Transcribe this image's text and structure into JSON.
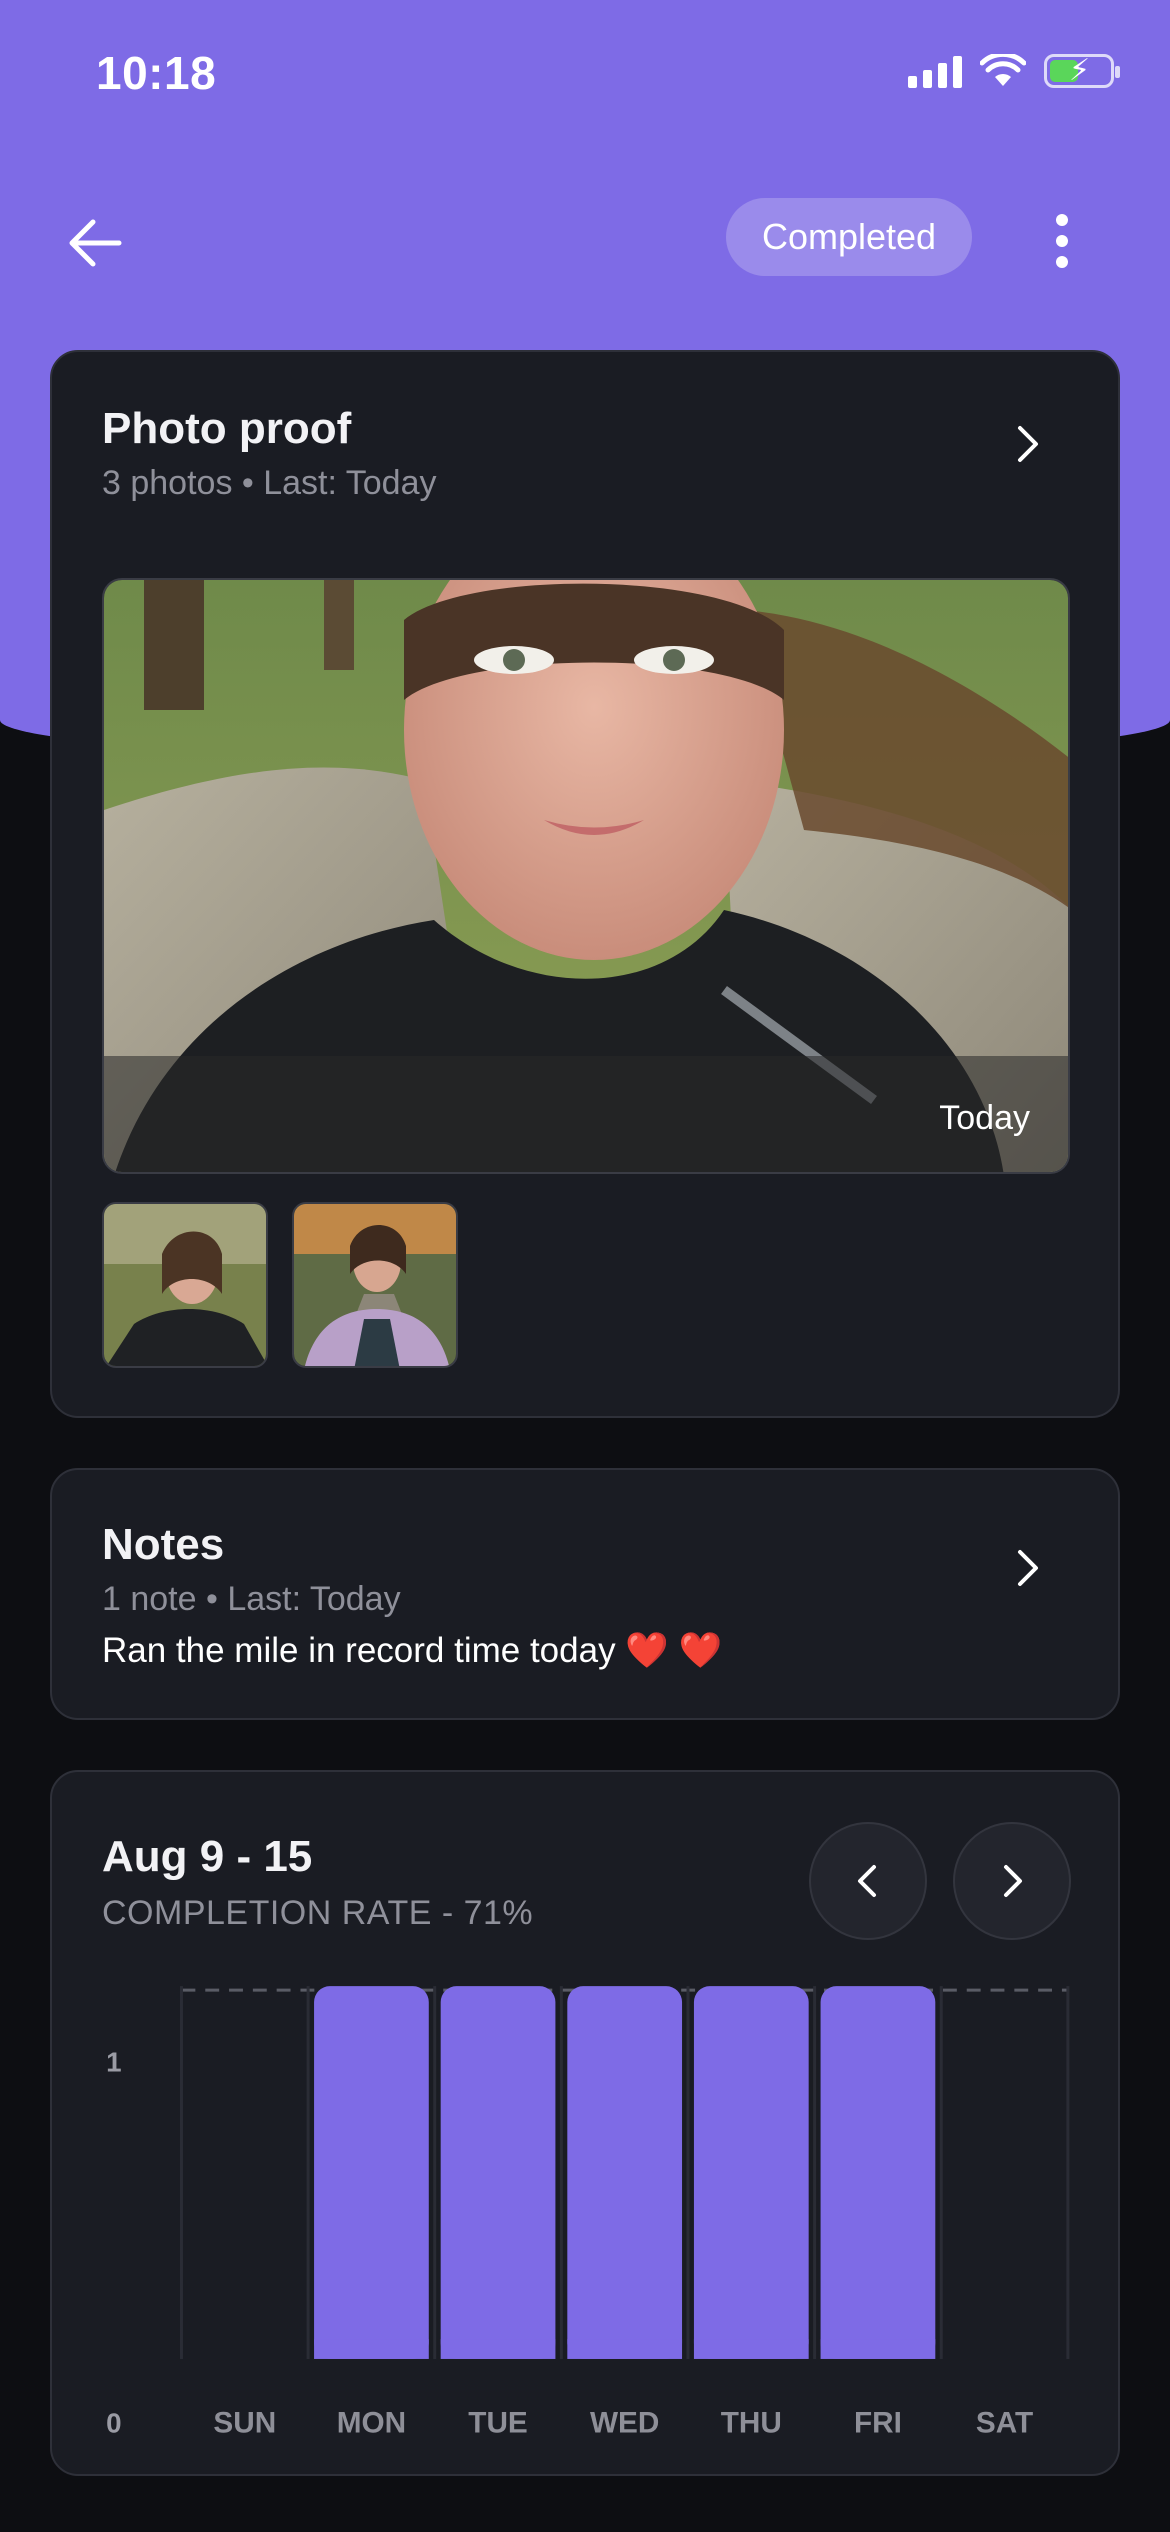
{
  "status_bar": {
    "time": "10:18"
  },
  "nav": {
    "status_pill": "Completed"
  },
  "photo_proof": {
    "title": "Photo proof",
    "subtitle": "3 photos • Last: Today",
    "main_caption": "Today"
  },
  "notes": {
    "title": "Notes",
    "subtitle": "1 note • Last: Today",
    "latest_note": "Ran the mile in record time today ❤️ ❤️"
  },
  "weekly": {
    "range": "Aug 9 - 15",
    "completion": "COMPLETION RATE - 71%"
  },
  "colors": {
    "accent": "#7e6be6",
    "card": "#1a1c23",
    "background": "#0d0e12"
  },
  "chart_data": {
    "type": "bar",
    "categories": [
      "SUN",
      "MON",
      "TUE",
      "WED",
      "THU",
      "FRI",
      "SAT"
    ],
    "values": [
      0,
      1,
      1,
      1,
      1,
      1,
      0
    ],
    "y_ticks": [
      "0",
      "1"
    ],
    "ylim": [
      0,
      1
    ]
  }
}
